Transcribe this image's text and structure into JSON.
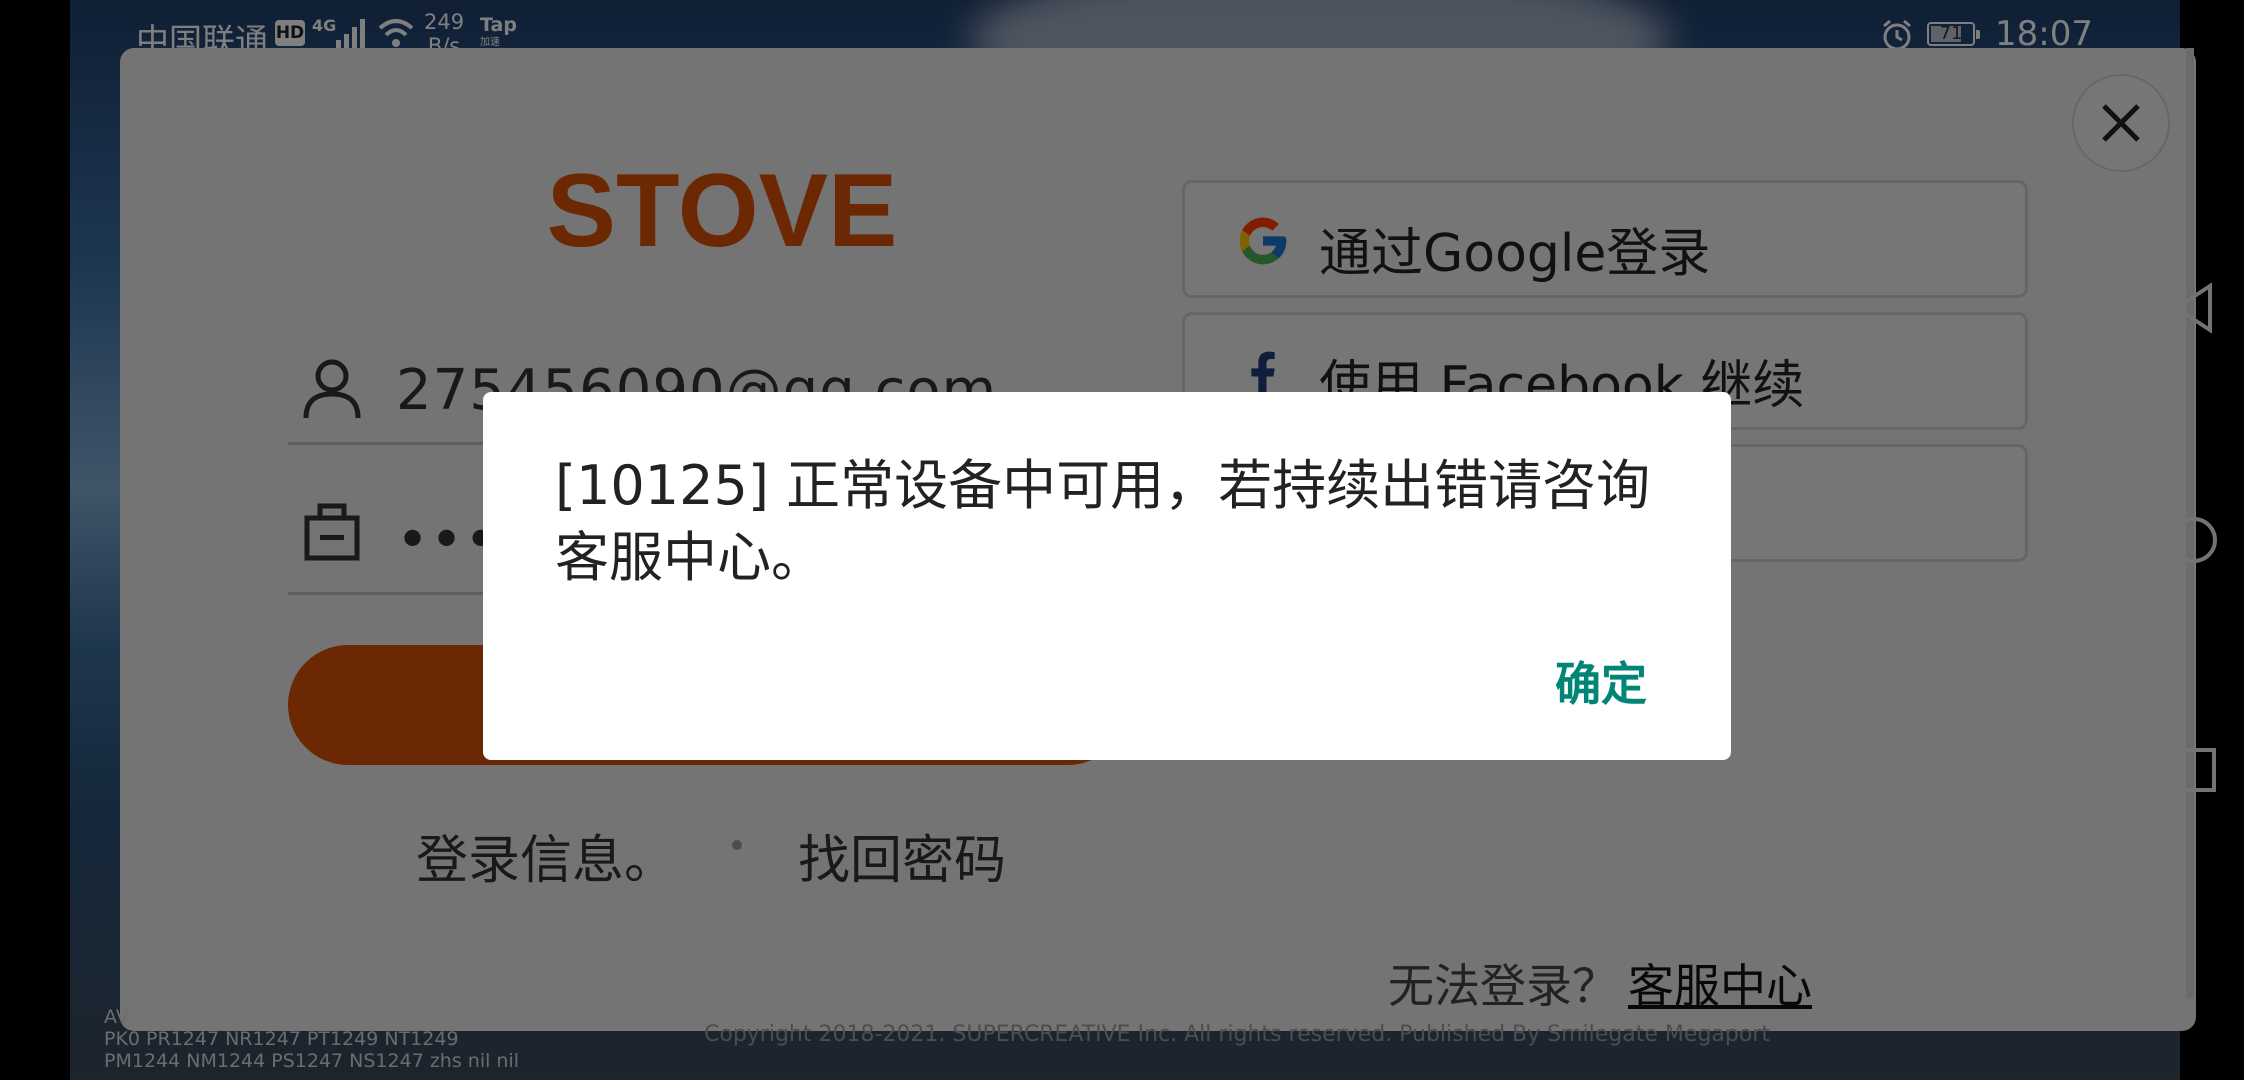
{
  "status_bar": {
    "carrier": "中国联通",
    "hd_badge": "HD",
    "network_type": "4G",
    "speed_value": "249",
    "speed_unit": "B/s",
    "tap_label": "Tap",
    "tap_sub": "加速",
    "battery": "71",
    "time": "18:07",
    "icons": [
      "hd-icon",
      "signal-icon",
      "wifi-icon",
      "alarm-icon",
      "battery-icon"
    ]
  },
  "login": {
    "logo_text": "STOVE",
    "email_value": "275456090@qq.com",
    "password_value": "••••••••",
    "login_info_link": "登录信息。",
    "find_password_link": "找回密码",
    "google_label": "通过Google登录",
    "facebook_label": "使用 Facebook 继续",
    "cant_login_text": "无法登录？",
    "support_link": "客服中心",
    "copyright": "Copyright 2018-2021. SUPERCREATIVE Inc. All rights reserved. Published By Smilegate Megaport",
    "version_lines": [
      "AV",
      "PK0 PR1247 NR1247 PT1249 NT1249",
      "PM1244 NM1244 PS1247 NS1247 zhs nil nil"
    ]
  },
  "dialog": {
    "message": "[10125] 正常设备中可用，若持续出错请咨询客服中心。",
    "confirm_label": "确定"
  },
  "colors": {
    "brand_orange": "#d65106",
    "confirm_teal": "#008577",
    "google_blue": "#4285F4",
    "facebook_blue": "#1877F2"
  }
}
